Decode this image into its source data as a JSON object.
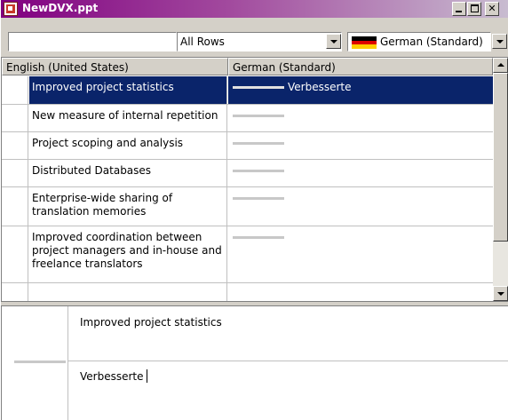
{
  "window": {
    "title": "NewDVX.ppt"
  },
  "toolbar": {
    "filter_value": "All Rows",
    "language_value": "German (Standard)",
    "flag_colors": [
      "#000000",
      "#dd0000",
      "#ffce00"
    ]
  },
  "grid": {
    "columns": [
      "English (United States)",
      "German (Standard)"
    ],
    "rows": [
      {
        "source": "Improved project statistics",
        "target": "Verbesserte",
        "selected": true
      },
      {
        "source": "New measure of internal repetition",
        "target": ""
      },
      {
        "source": "Project scoping and analysis",
        "target": ""
      },
      {
        "source": "Distributed Databases",
        "target": ""
      },
      {
        "source": "Enterprise-wide sharing of translation memories",
        "target": ""
      },
      {
        "source": "Improved coordination between project managers and in-house and freelance translators",
        "target": ""
      }
    ]
  },
  "editor": {
    "source_text": "Improved project statistics",
    "target_text": "Verbesserte"
  },
  "colors": {
    "selection": "#0a246a",
    "titlebar_start": "#800080"
  }
}
